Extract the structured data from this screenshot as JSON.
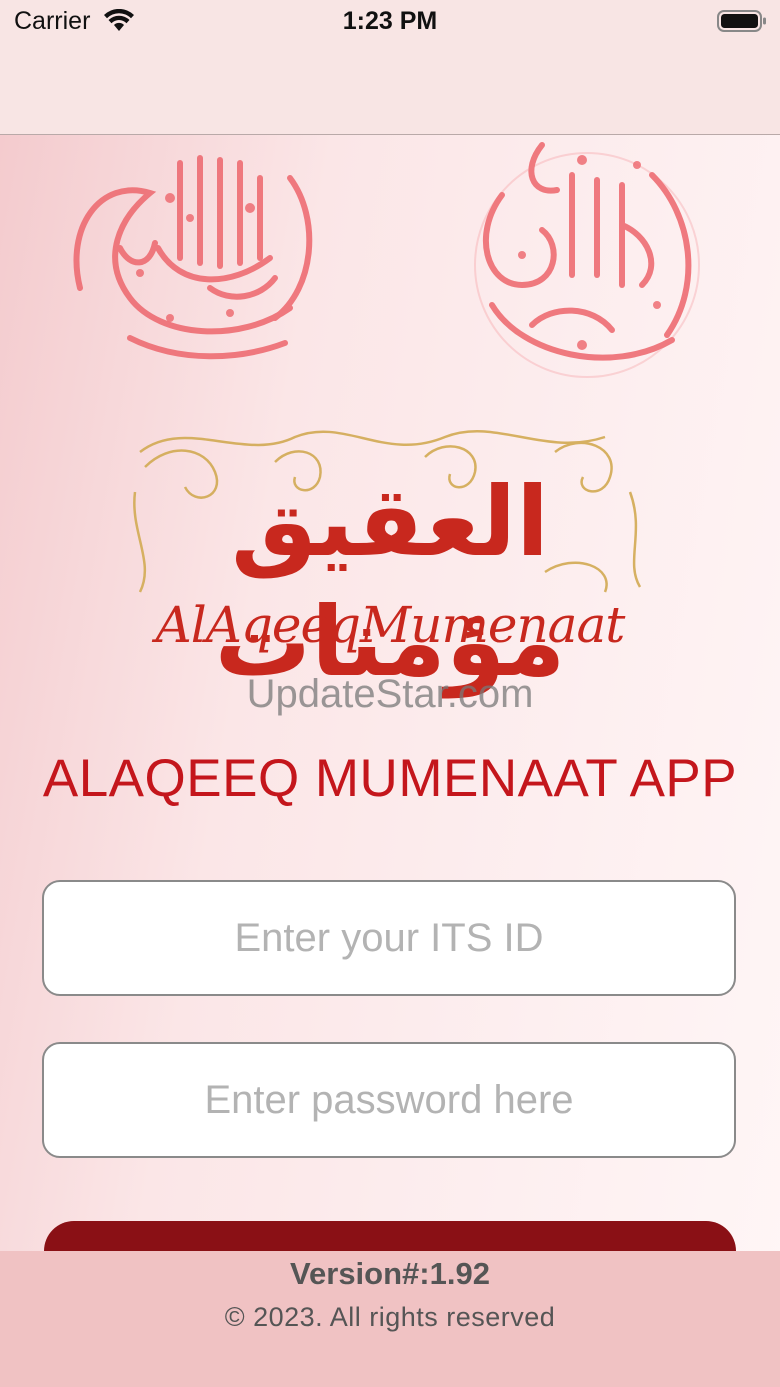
{
  "status_bar": {
    "carrier": "Carrier",
    "time": "1:23 PM",
    "icons": [
      "wifi-icon",
      "battery-icon"
    ]
  },
  "header": {
    "left_seal": "calligraphy-seal-left",
    "right_seal": "calligraphy-seal-right"
  },
  "logo": {
    "arabic_text": "العقيق مؤمنات",
    "latin_text": "AlAqeeqMumenaat"
  },
  "watermark": "UpdateStar.com",
  "app_title": "ALAQEEQ MUMENAAT APP",
  "form": {
    "its_id_value": "",
    "its_id_placeholder": "Enter your ITS ID",
    "password_value": "",
    "password_placeholder": "Enter password here"
  },
  "footer": {
    "version": "Version#:1.92",
    "copyright": "© 2023. All rights reserved"
  },
  "colors": {
    "title_red": "#c4161c",
    "button_dark_red": "#8a1015",
    "footer_pink": "#f0c2c3",
    "seal_pink": "#ee6d73",
    "ornament_gold": "#d4ad5a"
  }
}
